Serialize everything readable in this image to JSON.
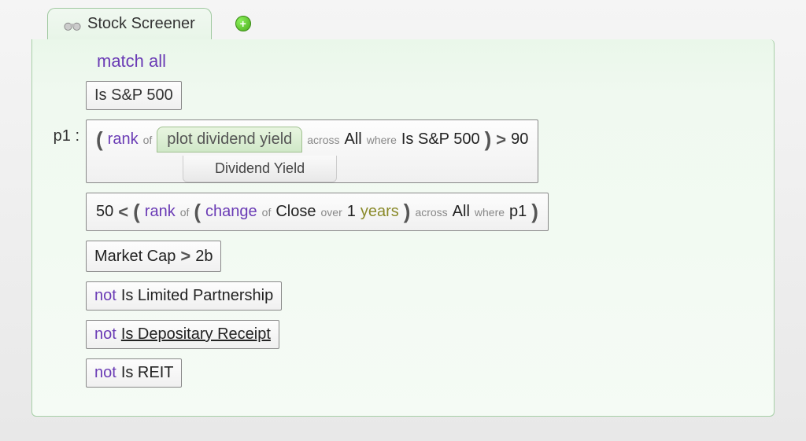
{
  "tab": {
    "title": "Stock Screener"
  },
  "header": {
    "match_all": "match all"
  },
  "rules": {
    "r1": {
      "text": "Is S&P 500"
    },
    "p1": {
      "label": "p1 :",
      "lparen": "(",
      "rank": "rank",
      "of": "of",
      "plot": "plot dividend yield",
      "across": "across",
      "all": "All",
      "where": "where",
      "cond": "Is S&P 500",
      "rparen": ")",
      "op": ">",
      "val": "90",
      "dropdown": "Dividend Yield"
    },
    "r3": {
      "v50": "50",
      "lt": "<",
      "lparen1": "(",
      "rank": "rank",
      "of1": "of",
      "lparen2": "(",
      "change": "change",
      "of2": "of",
      "close": "Close",
      "over": "over",
      "n1": "1",
      "years": "years",
      "rparen2": ")",
      "across": "across",
      "all": "All",
      "where": "where",
      "p1": "p1",
      "rparen1": ")"
    },
    "r4": {
      "field": "Market Cap",
      "op": ">",
      "val": "2b"
    },
    "r5": {
      "not": "not",
      "text": "Is Limited Partnership"
    },
    "r6": {
      "not": "not",
      "text": "Is Depositary Receipt"
    },
    "r7": {
      "not": "not",
      "text": "Is REIT"
    }
  }
}
